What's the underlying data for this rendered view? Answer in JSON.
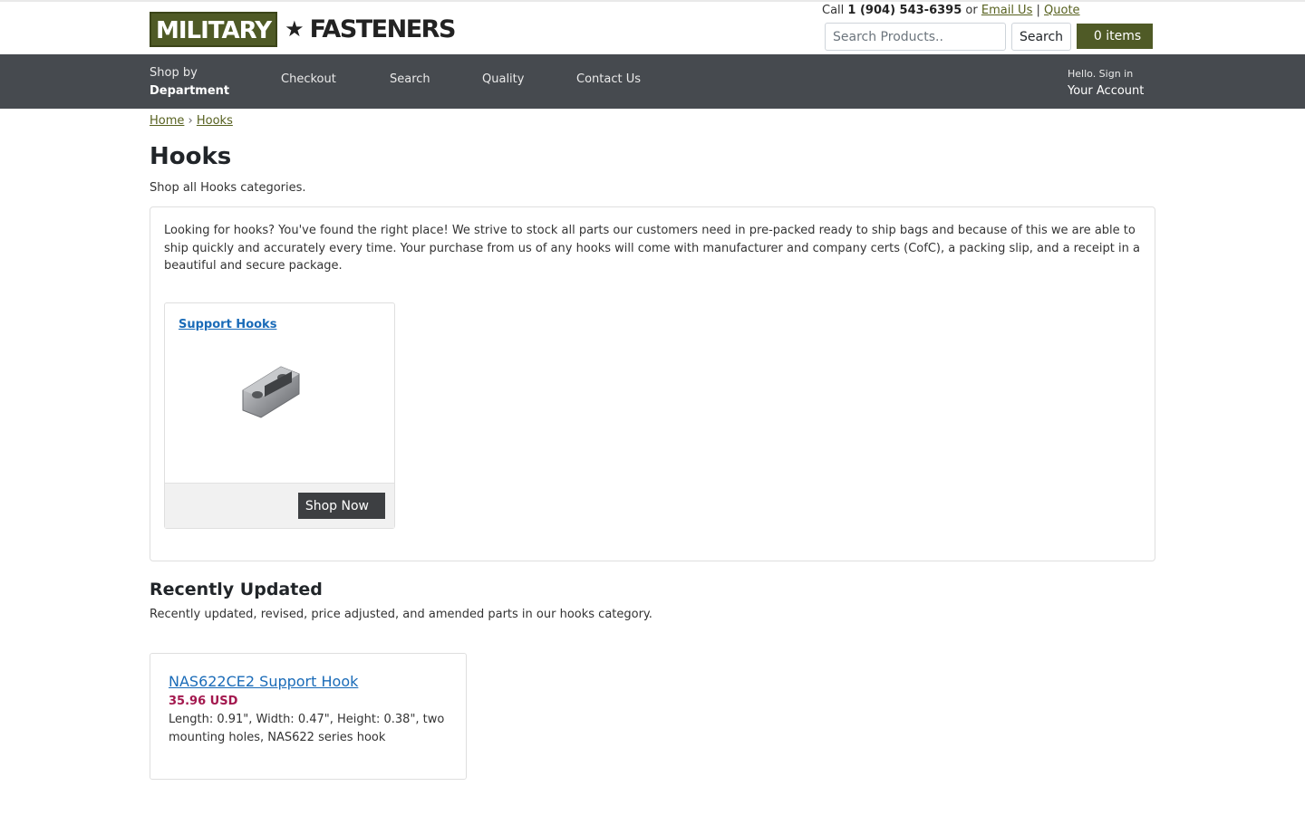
{
  "header": {
    "logo_left": "MILITARY",
    "logo_star": "★",
    "logo_right": "FASTENERS",
    "call_prefix": "Call",
    "phone": "1 (904) 543-6395",
    "or_text": "or",
    "email_link": "Email Us",
    "separator": "|",
    "quote_link": "Quote",
    "search_placeholder": "Search Products..",
    "search_button": "Search",
    "cart_icon": "",
    "cart_label": "0 items"
  },
  "nav": {
    "dept_small": "Shop by",
    "dept_big": "Department",
    "dept_icon": "",
    "items": [
      {
        "icon": "",
        "label": "Checkout"
      },
      {
        "icon": "",
        "label": "Search"
      },
      {
        "icon": "",
        "label": "Quality"
      },
      {
        "icon": "",
        "label": "Contact Us"
      }
    ],
    "account_small": "Hello. Sign in",
    "account_big": "Your Account"
  },
  "breadcrumb": {
    "home": "Home",
    "sep": "›",
    "current": "Hooks"
  },
  "page": {
    "title": "Hooks",
    "subtitle": "Shop all Hooks categories.",
    "description": "Looking for hooks? You've found the right place! We strive to stock all parts our customers need in pre-packed ready to ship bags and because of this we are able to ship quickly and accurately every time. Your purchase from us of any hooks will come with manufacturer and company certs (CofC), a packing slip, and a receipt in a beautiful and secure package."
  },
  "category": {
    "title": "Support Hooks",
    "button": "Shop Now",
    "button_icon": ""
  },
  "recent": {
    "title": "Recently Updated",
    "subtitle": "Recently updated, revised, price adjusted, and amended parts in our hooks category.",
    "part": {
      "name": "NAS622CE2 Support Hook",
      "price": "35.96 USD",
      "desc": "Length: 0.91\", Width: 0.47\", Height: 0.38\", two mounting holes, NAS622 series hook"
    }
  },
  "colors": {
    "brand_green": "#4f5a26",
    "nav_bg": "#464a4f",
    "link_blue": "#1a6bb8",
    "price": "#a3184e"
  }
}
